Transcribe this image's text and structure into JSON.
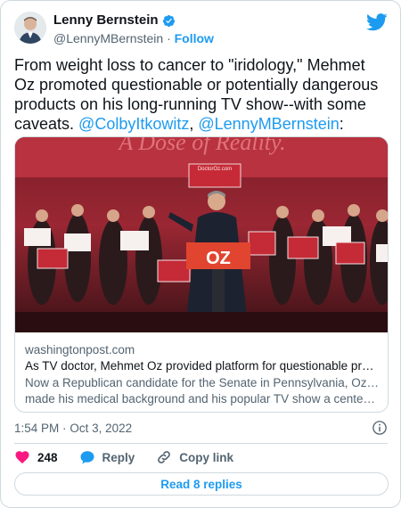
{
  "author": {
    "display_name": "Lenny Bernstein",
    "handle": "@LennyMBernstein",
    "separator": "·",
    "follow_label": "Follow"
  },
  "tweet": {
    "text_parts": [
      "From weight loss to cancer to \"iridology,\" Mehmet Oz promoted questionable or potentially dangerous products on his long-running TV show--with some caveats. ",
      ", ",
      ":"
    ],
    "mentions": [
      "@ColbyItkowitz",
      "@LennyMBernstein"
    ]
  },
  "link_card": {
    "domain": "washingtonpost.com",
    "title": "As TV doctor, Mehmet Oz provided platform for questionable prod...",
    "description_line1": "Now a Republican candidate for the Senate in Pennsylvania, Oz has",
    "description_line2": "made his medical background and his popular TV show a centerpiec...",
    "image": {
      "banner_text": "A Dose of Reality.",
      "podium_sign": "OZ",
      "crowd_sign": "OZ",
      "website_sign": "DoctorOz.com"
    }
  },
  "timestamp": {
    "time": "1:54 PM",
    "separator": "·",
    "date": "Oct 3, 2022"
  },
  "actions": {
    "like_count": "248",
    "reply_label": "Reply",
    "copy_link_label": "Copy link"
  },
  "read_replies_label": "Read 8 replies",
  "colors": {
    "accent": "#1d9bf0",
    "like": "#f91880",
    "text": "#0f1419",
    "muted": "#536471",
    "border": "#cfd9de"
  }
}
